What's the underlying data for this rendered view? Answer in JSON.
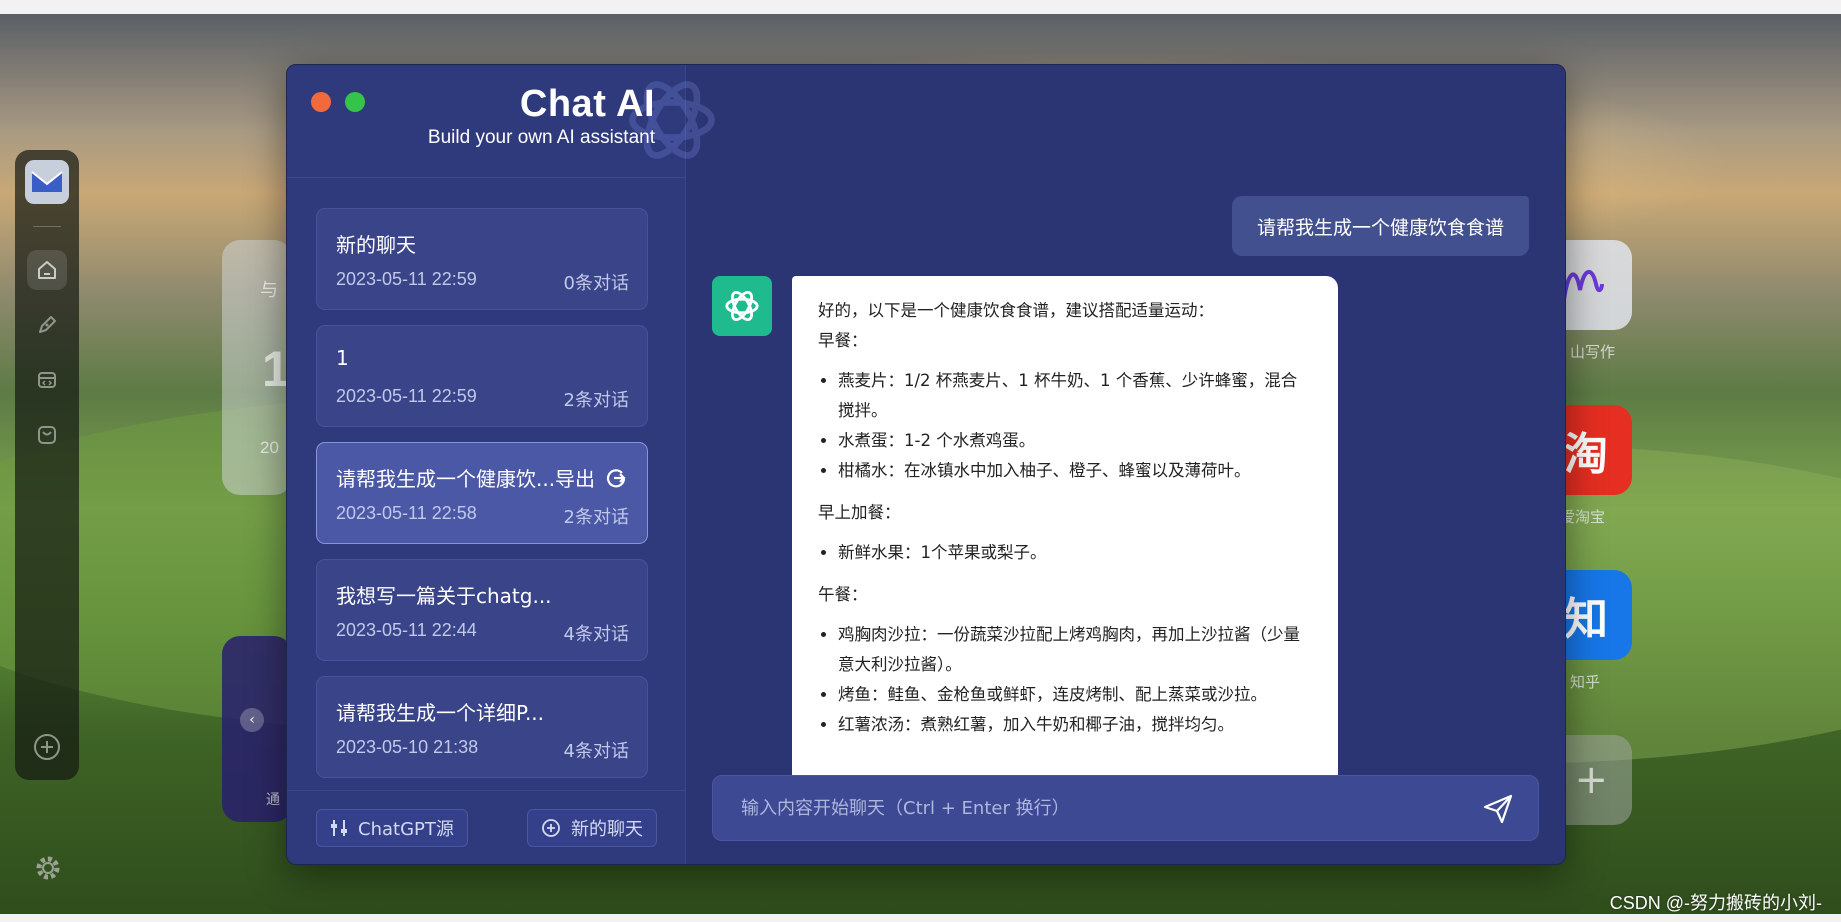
{
  "app": {
    "title": "Chat AI",
    "subtitle": "Build your own AI assistant"
  },
  "sidebar": {
    "chats": [
      {
        "title": "新的聊天",
        "date": "2023-05-11 22:59",
        "count": "0条对话",
        "active": false
      },
      {
        "title": "1",
        "date": "2023-05-11 22:59",
        "count": "2条对话",
        "active": false
      },
      {
        "title": "请帮我生成一个健康饮...",
        "export_label": "导出",
        "date": "2023-05-11 22:58",
        "count": "2条对话",
        "active": true
      },
      {
        "title": "我想写一篇关于chatg...",
        "date": "2023-05-11 22:44",
        "count": "4条对话",
        "active": false
      },
      {
        "title": "请帮我生成一个详细P...",
        "date": "2023-05-10 21:38",
        "count": "4条对话",
        "active": false
      }
    ],
    "footer": {
      "source_label": "ChatGPT源",
      "new_chat_label": "新的聊天"
    }
  },
  "conversation": {
    "user_message": "请帮我生成一个健康饮食食谱",
    "ai_response": {
      "intro": "好的，以下是一个健康饮食食谱，建议搭配适量运动：",
      "sections": [
        {
          "heading": "早餐：",
          "items": [
            "燕麦片：1/2 杯燕麦片、1 杯牛奶、1 个香蕉、少许蜂蜜，混合搅拌。",
            "水煮蛋：1-2 个水煮鸡蛋。",
            "柑橘水：在冰镇水中加入柚子、橙子、蜂蜜以及薄荷叶。"
          ]
        },
        {
          "heading": "早上加餐：",
          "items": [
            "新鲜水果：1个苹果或梨子。"
          ]
        },
        {
          "heading": "午餐：",
          "items": [
            "鸡胸肉沙拉：一份蔬菜沙拉配上烤鸡胸肉，再加上沙拉酱（少量意大利沙拉酱）。",
            "烤鱼：鲑鱼、金枪鱼或鲜虾，连皮烤制、配上蒸菜或沙拉。",
            "红薯浓汤：煮熟红薯，加入牛奶和椰子油，搅拌均匀。"
          ]
        }
      ]
    }
  },
  "composer": {
    "placeholder": "输入内容开始聊天（Ctrl + Enter 换行）"
  },
  "background": {
    "widget_left_label_top": "与",
    "widget_left_big": "1",
    "widget_left_small": "20",
    "purple_widget_label": "通",
    "tiles": [
      {
        "glyph": "",
        "label": "山写作"
      },
      {
        "glyph": "淘",
        "label": "爱淘宝"
      },
      {
        "glyph": "知",
        "label": "知乎"
      },
      {
        "glyph": "+",
        "label": ""
      }
    ]
  },
  "watermark": "CSDN @-努力搬砖的小刘-",
  "colors": {
    "window_bg": "#2c3573",
    "sidebar_bg": "#2e3a7c",
    "active_card": "#4b58a5",
    "gpt_green": "#1fba8e",
    "dot_orange": "#f26a3b",
    "dot_green": "#34c44a"
  }
}
